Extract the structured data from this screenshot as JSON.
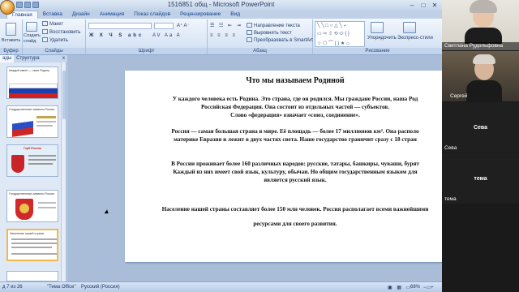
{
  "app": {
    "title": "1516851  общ  -  Microsoft PowerPoint",
    "window_controls": [
      "–",
      "□",
      "✕"
    ]
  },
  "tabs": [
    "Главная",
    "Вставка",
    "Дизайн",
    "Анимация",
    "Показ слайдов",
    "Рецензирование",
    "Вид"
  ],
  "ribbon": {
    "clipboard_label": "Буфер обмена",
    "paste_label": "Вставить",
    "slides_label": "Слайды",
    "create_slide_label": "Создать\nслайд",
    "layout_label": "Макет",
    "reset_label": "Восстановить",
    "delete_label": "Удалить",
    "font_label": "Шрифт",
    "paragraph_label": "Абзац",
    "text_direction": "Направление текста",
    "align_text": "Выровнять текст",
    "convert_smartart": "Преобразовать в SmartArt",
    "drawing_label": "Рисование",
    "arrange_label": "Упорядочить",
    "quick_styles_label": "Экспресс-стили"
  },
  "left_pane": {
    "tab_slides": "ады",
    "tab_structure": "Структура",
    "close_icon": "x",
    "thumbs": [
      "Каждый имеет — свою Родину",
      "Государственные символы России",
      "Герб России",
      "Государственные символы России",
      "Население нашей страны"
    ]
  },
  "slide": {
    "title": "Что мы называем Родиной",
    "p1": [
      "У каждого человека есть Родина. Это страна, где он родился. Мы граждане России, наша Род",
      "Российская Федерация.  Она состоит из отдельных частей — субъектов.",
      "Слово «федерация» означает «союз, соединение»."
    ],
    "p2": [
      "Россия — самая большая страна в мире. Её площадь — более 17 миллионов км². Она располо",
      "материке Евразия и лежит в двух частях света. Наше государство граничит сразу с 18 стран"
    ],
    "p3": [
      "В России проживает более 160 различных народов: русские, татары, башкиры, чуваши, бурят",
      "Каждый из них имеет свой язык, культуру, обычаи. Но общим государственным языком для",
      "является русский язык."
    ],
    "p4": [
      "Население нашей страны составляет более 150 млн человек. Россия располагает всеми важнейшими",
      "ресурсами для своего развития."
    ]
  },
  "status": {
    "slide_counter": "д 7 из 26",
    "theme": "\"Тема Office\"",
    "language": "Русский (Россия)",
    "zoom": "68%"
  },
  "video_participants": [
    {
      "name": "Светлана Рудольфовна",
      "center": ""
    },
    {
      "name": "Сергей",
      "center": ""
    },
    {
      "name": "Сева",
      "center": "Сева"
    },
    {
      "name": "тема",
      "center": "тема"
    }
  ]
}
